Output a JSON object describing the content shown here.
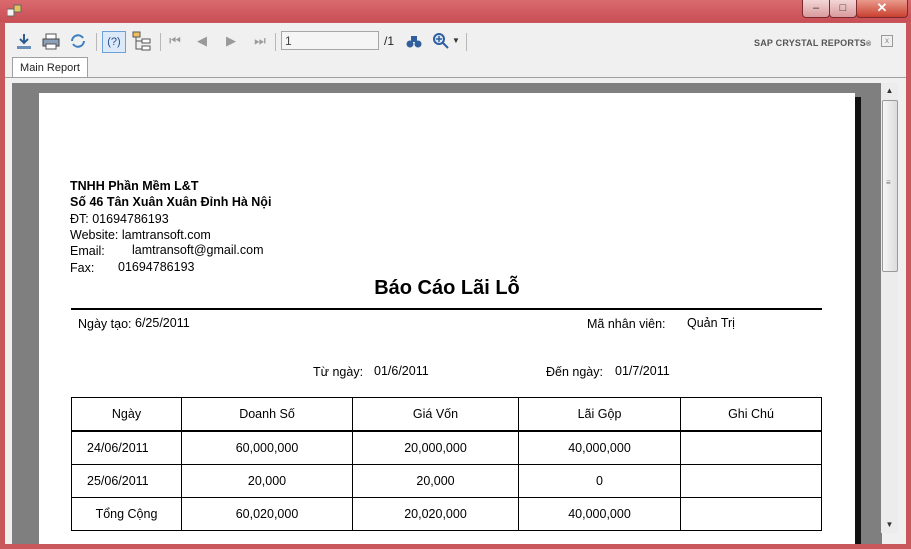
{
  "window": {
    "title": "",
    "min": "–",
    "max": "□",
    "close": "✕"
  },
  "toolbar": {
    "page_value": "1",
    "page_total": "/1",
    "help": "(?)",
    "brand": "SAP CRYSTAL REPORTS",
    "brand_close": "x"
  },
  "tabs": [
    {
      "label": "Main Report"
    }
  ],
  "report": {
    "company": "TNHH Phần Mềm L&T",
    "address": "Số 46 Tân Xuân Xuân Đỉnh Hà Nội",
    "phone_label": "ĐT:",
    "phone": "01694786193",
    "website_label": "Website:",
    "website": "lamtransoft.com",
    "email_label": "Email:",
    "email": "lamtransoft@gmail.com",
    "fax_label": "Fax:",
    "fax": "01694786193",
    "title": "Báo Cáo Lãi Lỗ",
    "created_label": "Ngày tạo:",
    "created": "6/25/2011",
    "employee_label": "Mã nhân viên:",
    "employee": "Quản Trị",
    "from_label": "Từ ngày:",
    "from": "01/6/2011",
    "to_label": "Đến ngày:",
    "to": "01/7/2011",
    "columns": [
      "Ngày",
      "Doanh Số",
      "Giá Vốn",
      "Lãi Gộp",
      "Ghi Chú"
    ],
    "rows": [
      [
        "24/06/2011",
        "60,000,000",
        "20,000,000",
        "40,000,000",
        ""
      ],
      [
        "25/06/2011",
        "20,000",
        "20,000",
        "0",
        ""
      ]
    ],
    "total": [
      "Tổng Cộng",
      "60,020,000",
      "20,020,000",
      "40,000,000",
      ""
    ]
  }
}
